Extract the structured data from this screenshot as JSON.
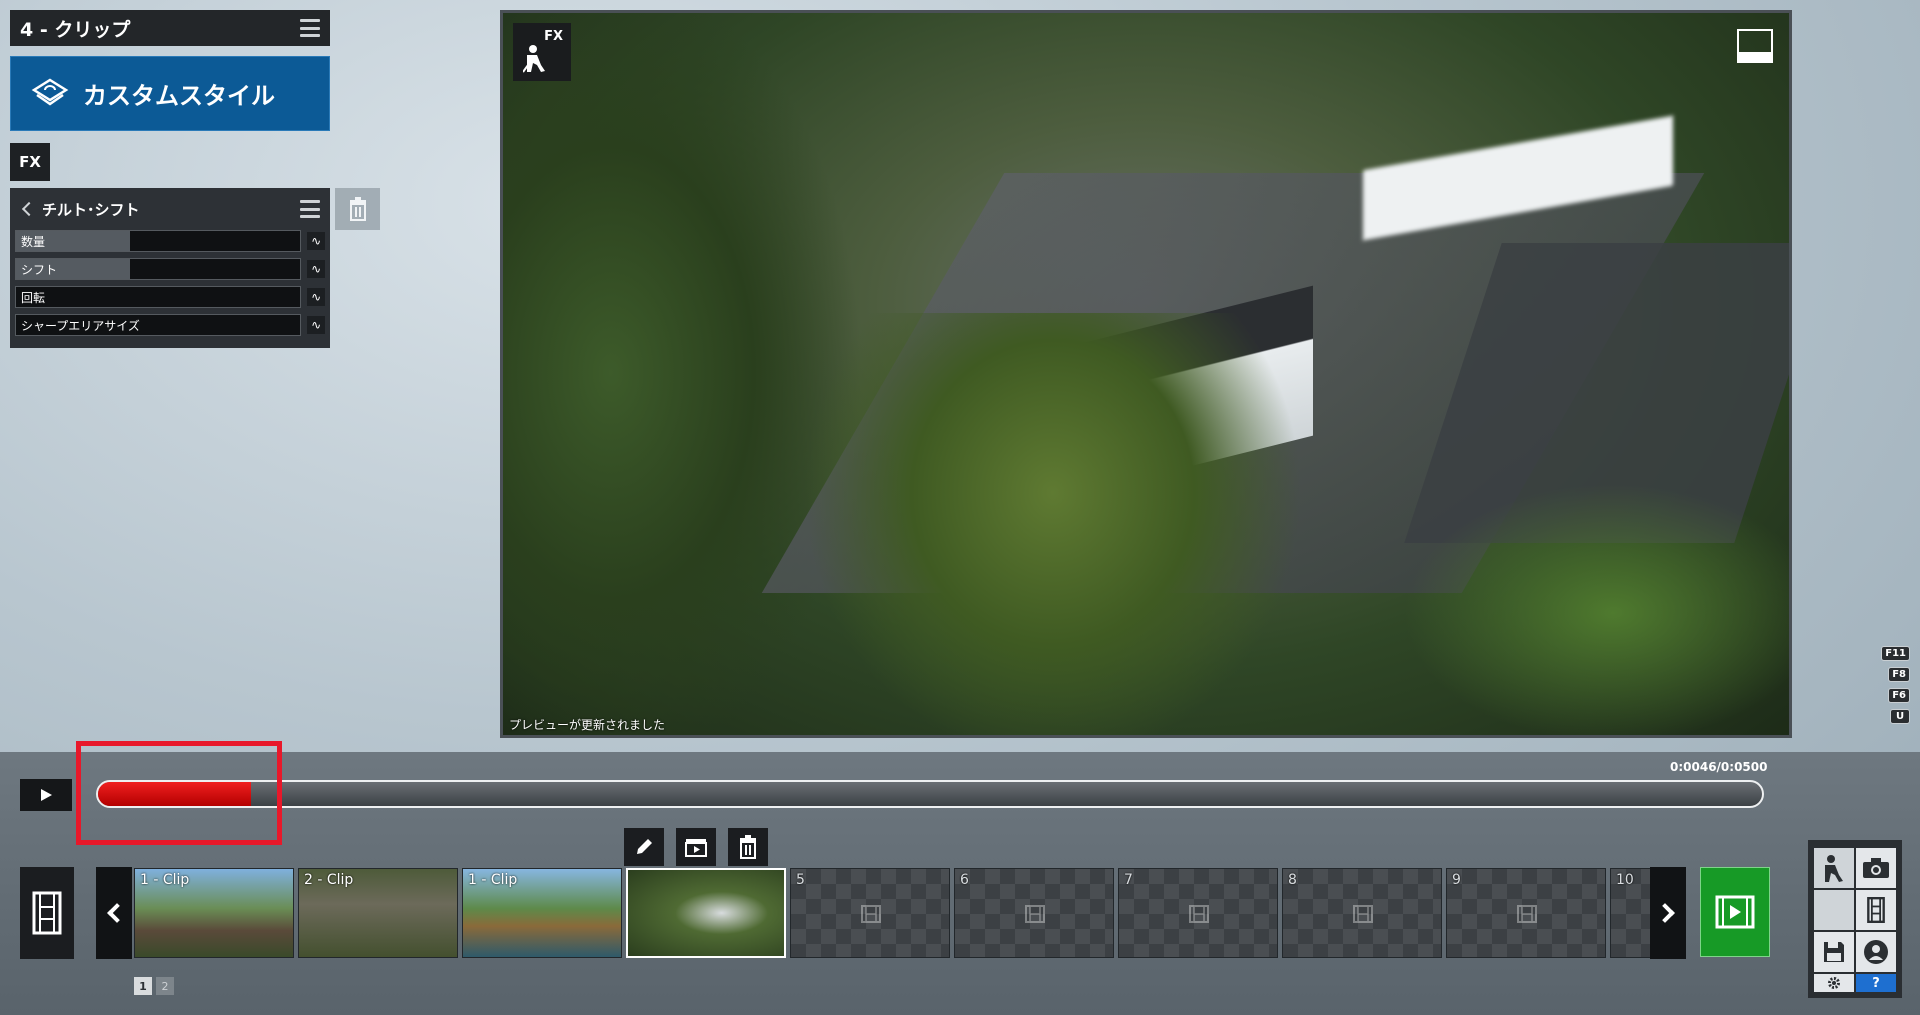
{
  "clip_panel": {
    "title": "4 - クリップ",
    "style_label": "カスタムスタイル",
    "fx_label": "FX"
  },
  "effect": {
    "name": "チルト･シフト",
    "params": [
      {
        "label": "数量",
        "fill": 0.4
      },
      {
        "label": "シフト",
        "fill": 0.4
      },
      {
        "label": "回転",
        "fill": 0.0
      },
      {
        "label": "シャープエリアサイズ",
        "fill": 0.0
      }
    ],
    "curve_glyph": "∿"
  },
  "preview": {
    "fx_label": "FX",
    "status": "プレビューが更新されました"
  },
  "function_keys": [
    "F11",
    "F8",
    "F6",
    "U"
  ],
  "timeline": {
    "time_text": "0:0046/0:0500",
    "progress": 0.092
  },
  "clips": [
    {
      "label": "1 - Clip",
      "style": "filled1"
    },
    {
      "label": "2 - Clip",
      "style": "filled2"
    },
    {
      "label": "1 - Clip",
      "style": "filled3"
    },
    {
      "label": "",
      "style": "filled4"
    },
    {
      "label": "5",
      "style": "empty"
    },
    {
      "label": "6",
      "style": "empty"
    },
    {
      "label": "7",
      "style": "empty"
    },
    {
      "label": "8",
      "style": "empty"
    },
    {
      "label": "9",
      "style": "empty"
    },
    {
      "label": "10",
      "style": "empty"
    }
  ],
  "pager": [
    "1",
    "2"
  ],
  "help_label": "?",
  "colors": {
    "accent_blue": "#0c5a96",
    "export_green": "#179a26",
    "progress_red": "#d00000",
    "highlight_red": "#e8182a"
  }
}
